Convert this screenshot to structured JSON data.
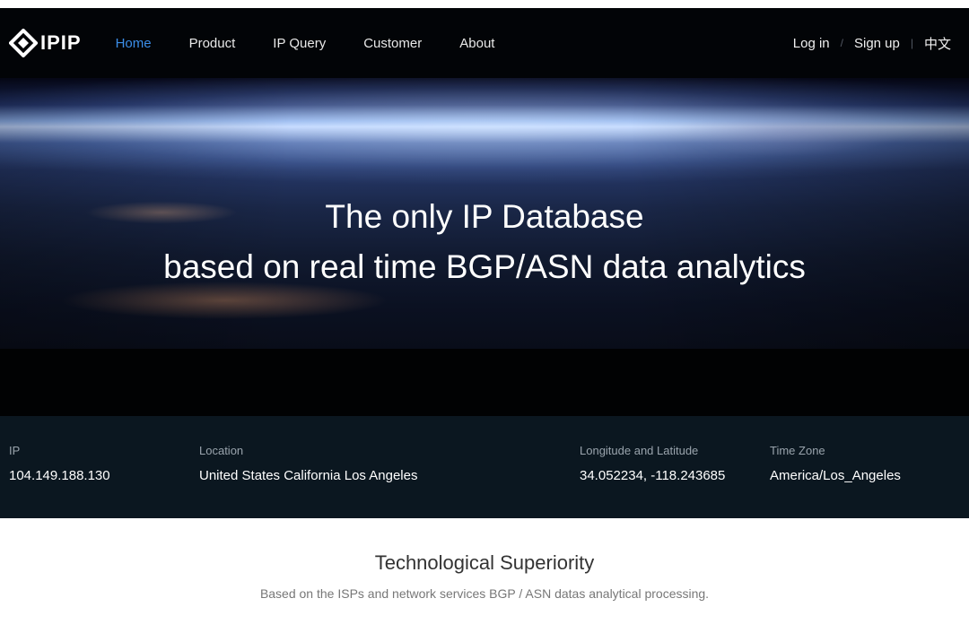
{
  "brand": {
    "logo_text": "IPIP"
  },
  "nav": {
    "links": [
      "Home",
      "Product",
      "IP Query",
      "Customer",
      "About"
    ],
    "active_index": 0,
    "login": "Log in",
    "signup": "Sign up",
    "separator": "/",
    "separator2": "|",
    "language": "中文"
  },
  "hero": {
    "line1": "The only IP Database",
    "line2": "based on real time BGP/ASN data analytics"
  },
  "ip_info": {
    "ip_label": "IP",
    "ip_value": "104.149.188.130",
    "location_label": "Location",
    "location_value": "United States California Los Angeles",
    "coords_label": "Longitude and Latitude",
    "coords_value": "34.052234, -118.243685",
    "timezone_label": "Time Zone",
    "timezone_value": "America/Los_Angeles"
  },
  "section": {
    "title": "Technological Superiority",
    "subtitle": "Based on the ISPs and network services BGP / ASN datas analytical processing."
  },
  "colors": {
    "accent": "#3b8ee8",
    "nav_bg": "#020408",
    "info_bg": "#0b1720"
  }
}
